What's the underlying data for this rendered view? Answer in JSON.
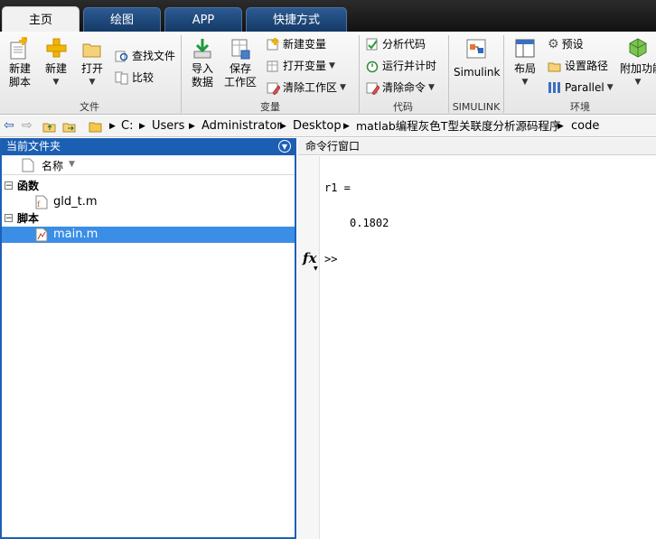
{
  "tabs": [
    {
      "label": "主页",
      "active": true
    },
    {
      "label": "绘图",
      "active": false
    },
    {
      "label": "APP",
      "active": false
    },
    {
      "label": "快捷方式",
      "active": false
    }
  ],
  "ribbon": {
    "file": {
      "new_script": "新建\n脚本",
      "new": "新建",
      "open": "打开",
      "find_files": "查找文件",
      "compare": "比较",
      "group_label": "文件"
    },
    "variable": {
      "import_data": "导入\n数据",
      "save_workspace": "保存\n工作区",
      "new_variable": "新建变量",
      "open_variable": "打开变量",
      "clear_workspace": "清除工作区",
      "group_label": "变量"
    },
    "code": {
      "analyze_code": "分析代码",
      "run_and_time": "运行并计时",
      "clear_commands": "清除命令",
      "group_label": "代码"
    },
    "simulink": {
      "simulink": "Simulink",
      "group_label": "SIMULINK"
    },
    "environment": {
      "layout": "布局",
      "preferences": "预设",
      "set_path": "设置路径",
      "parallel": "Parallel",
      "addons": "附加功能",
      "group_label": "环境"
    }
  },
  "address": {
    "crumbs": [
      "C:",
      "Users",
      "Administrator",
      "Desktop",
      "matlab编程灰色T型关联度分析源码程序",
      "code"
    ]
  },
  "file_browser": {
    "title": "当前文件夹",
    "column_name": "名称",
    "groups": [
      {
        "label": "函数",
        "files": [
          {
            "name": "gld_t.m",
            "selected": false
          }
        ]
      },
      {
        "label": "脚本",
        "files": [
          {
            "name": "main.m",
            "selected": true
          }
        ]
      }
    ]
  },
  "command_window": {
    "title": "命令行窗口",
    "lines": [
      "r1 =",
      "0.1802"
    ],
    "prompt": ">>",
    "fx": "fx"
  },
  "colors": {
    "tab_blue": "#1d4a80",
    "panel_header": "#1b5fb3",
    "selection": "#3a8ee6"
  }
}
